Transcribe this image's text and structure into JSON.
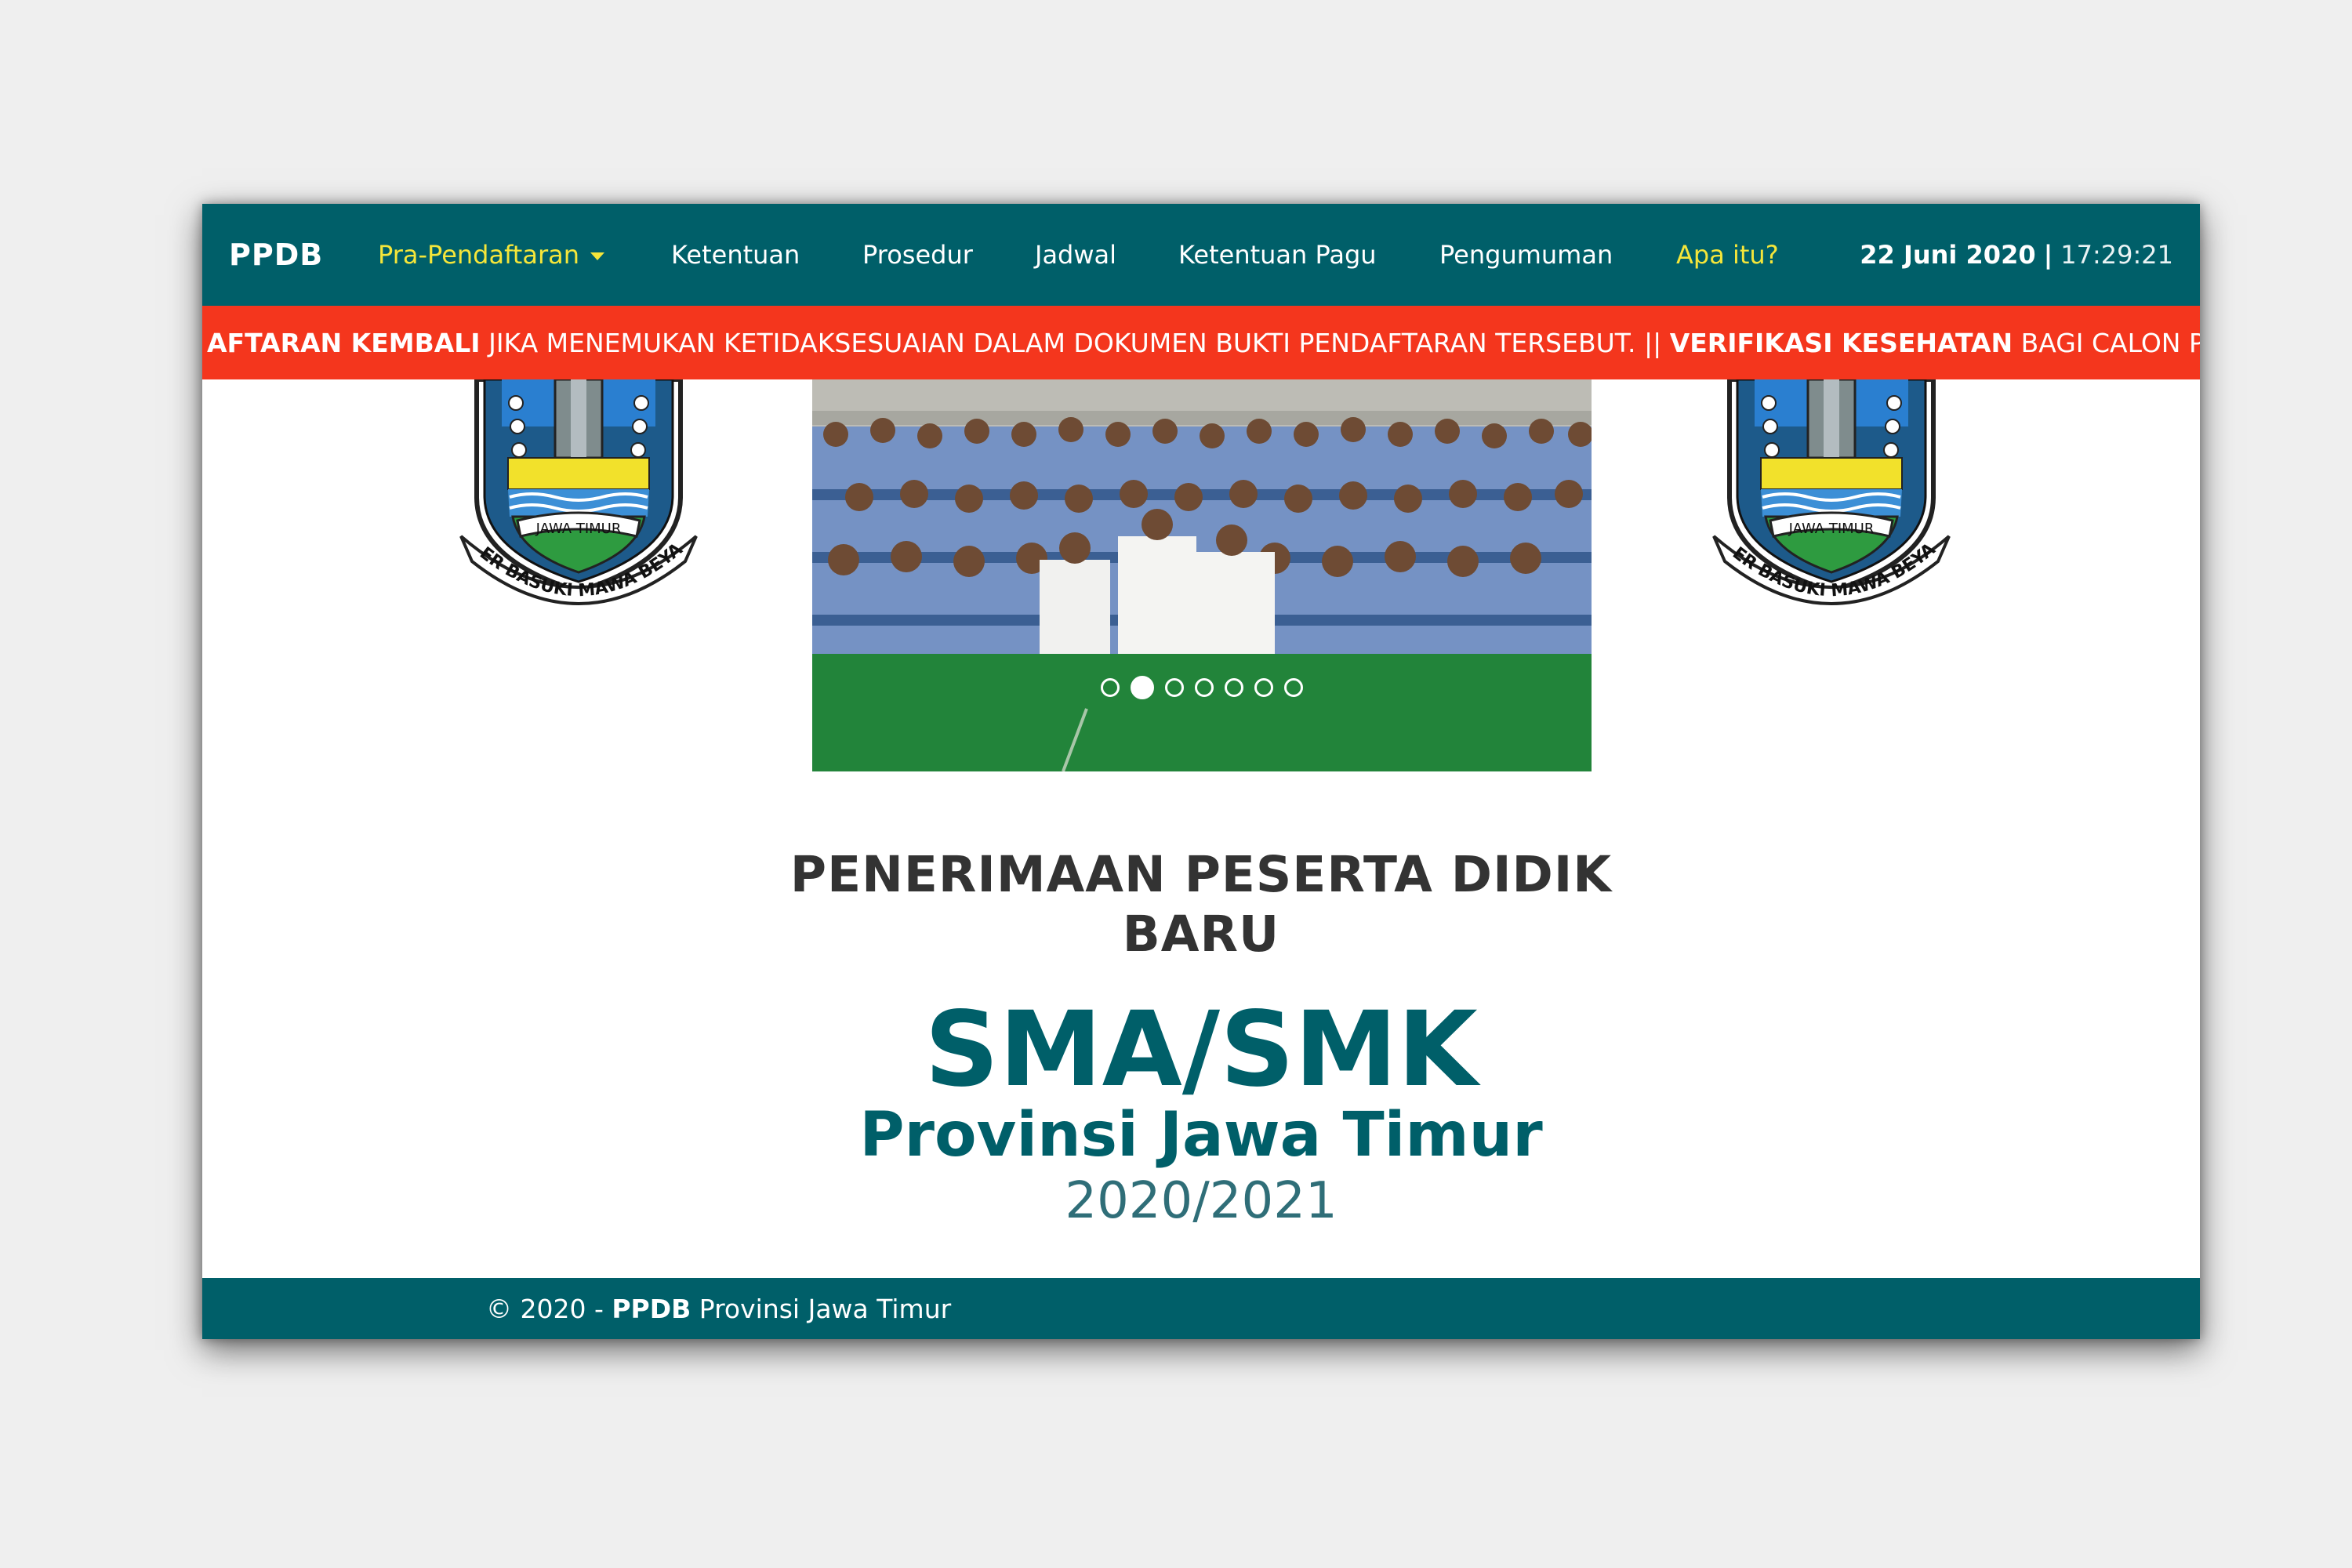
{
  "navbar": {
    "brand": "PPDB",
    "items": [
      {
        "label": "Pra-Pendaftaran",
        "highlight": true,
        "dropdown": true
      },
      {
        "label": "Ketentuan"
      },
      {
        "label": "Prosedur"
      },
      {
        "label": "Jadwal"
      },
      {
        "label": "Ketentuan Pagu"
      },
      {
        "label": "Pengumuman"
      },
      {
        "label": "Apa itu?",
        "highlight": true
      }
    ],
    "date": "22 Juni 2020",
    "separator": "|",
    "time": "17:29:21",
    "colors": {
      "background": "#005f69",
      "highlight": "#f5e63a"
    }
  },
  "ticker": {
    "bold_1": "AFTARAN KEMBALI",
    "text_1": " JIKA MENEMUKAN KETIDAKSESUAIAN DALAM DOKUMEN BUKTI PENDAFTARAN TERSEBUT. || ",
    "bold_2": "VERIFIKASI KESEHATAN",
    "text_2": " BAGI CALON PESER",
    "color": "#f4361d"
  },
  "logos": {
    "left": {
      "icon": "jawa-timur-emblem-icon",
      "ribbon": "JAWA TIMUR",
      "motto": "JER BASUKI MAWA BEYA"
    },
    "right": {
      "icon": "jawa-timur-emblem-icon",
      "ribbon": "JAWA TIMUR",
      "motto": "JER BASUKI MAWA BEYA"
    }
  },
  "carousel": {
    "slide_count": 7,
    "active_index": 1
  },
  "hero": {
    "title_line1": "PENERIMAAN PESERTA DIDIK",
    "title_line2": "BARU",
    "main": "SMA/SMK",
    "sub": "Provinsi Jawa Timur",
    "year": "2020/2021"
  },
  "footer": {
    "prefix": "© 2020 - ",
    "brand": "PPDB",
    "suffix": " Provinsi Jawa Timur"
  }
}
